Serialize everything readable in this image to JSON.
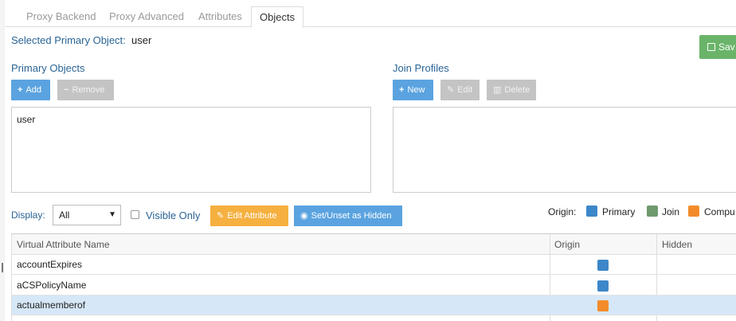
{
  "tabs": [
    {
      "label": "Proxy Backend"
    },
    {
      "label": "Proxy Advanced"
    },
    {
      "label": "Attributes"
    },
    {
      "label": "Objects"
    }
  ],
  "selected_primary": {
    "label": "Selected Primary Object:",
    "value": "user"
  },
  "save_button": {
    "label": "Sav",
    "icon": "floppy-disk-icon"
  },
  "primary_objects": {
    "title": "Primary Objects",
    "add_label": "Add",
    "remove_label": "Remove",
    "items": [
      "user"
    ]
  },
  "join_profiles": {
    "title": "Join Profiles",
    "new_label": "New",
    "edit_label": "Edit",
    "delete_label": "Delete"
  },
  "filters": {
    "display_label": "Display:",
    "display_value": "All",
    "visible_only_label": "Visible Only",
    "visible_only_checked": false,
    "edit_attribute_label": "Edit Attribute",
    "set_hidden_label": "Set/Unset as Hidden"
  },
  "origin_legend": {
    "label": "Origin:",
    "items": [
      {
        "label": "Primary",
        "color": "#3d87c9"
      },
      {
        "label": "Join",
        "color": "#6f9a6f"
      },
      {
        "label": "Compu",
        "color": "#f28c2a"
      }
    ]
  },
  "table": {
    "columns": [
      "Virtual Attribute Name",
      "Origin",
      "Hidden"
    ],
    "rows": [
      {
        "name": "accountExpires",
        "origin": "Primary",
        "origin_color": "#3d87c9",
        "selected": false
      },
      {
        "name": "aCSPolicyName",
        "origin": "Primary",
        "origin_color": "#3d87c9",
        "selected": false
      },
      {
        "name": "actualmemberof",
        "origin": "Computed",
        "origin_color": "#f28c2a",
        "selected": true
      }
    ]
  },
  "colors": {
    "accent": "#2a6496",
    "button_blue": "#5aa3e0",
    "button_orange": "#f5b040",
    "save_green": "#6ab46a"
  }
}
